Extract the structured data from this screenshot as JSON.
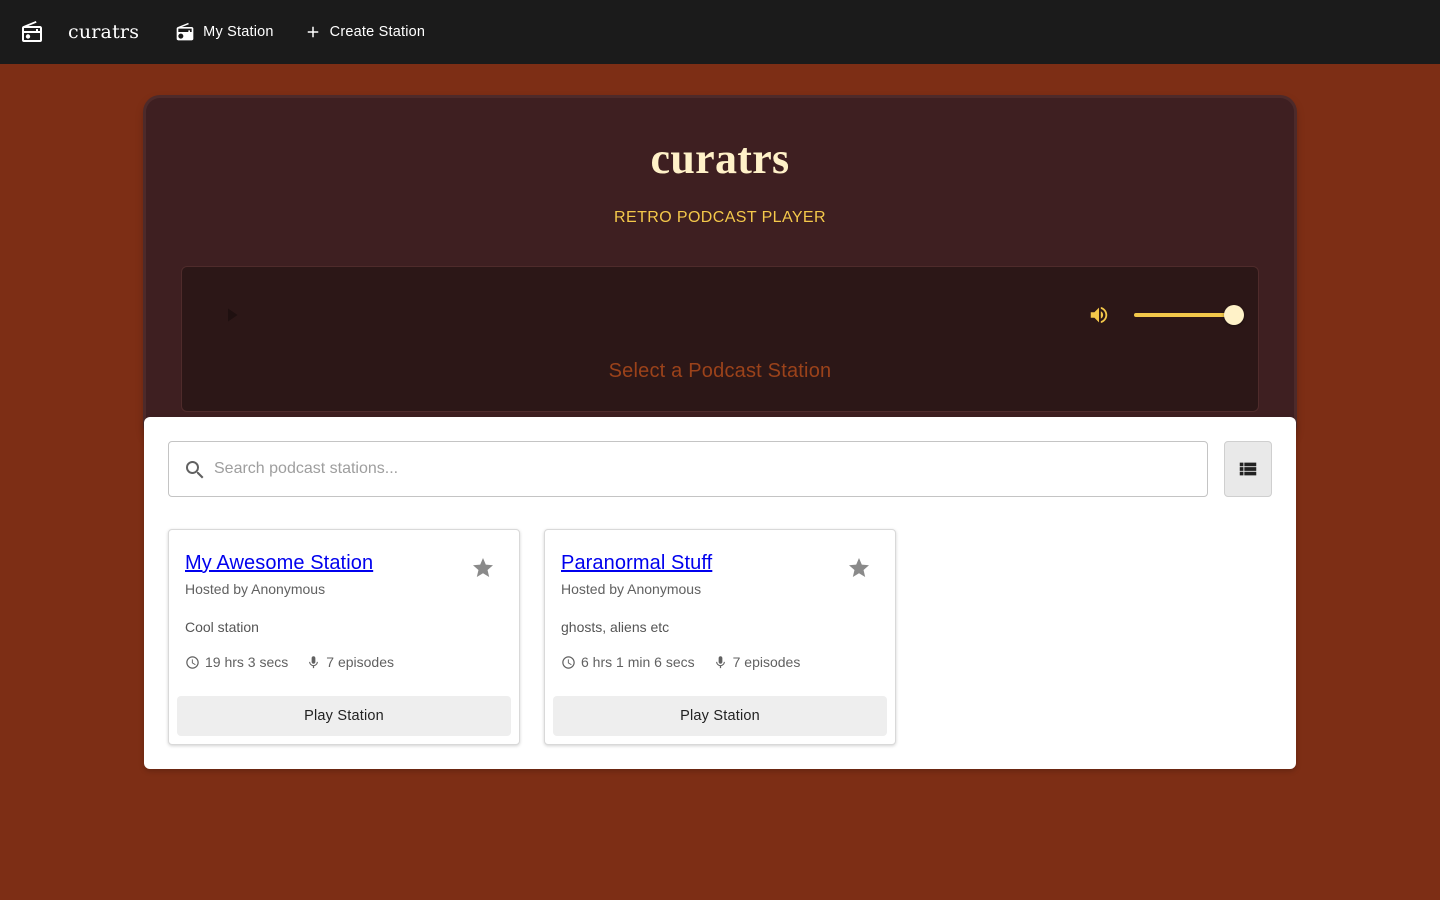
{
  "nav": {
    "brand": "curatrs",
    "my_station": "My Station",
    "create_station": "Create Station"
  },
  "player": {
    "title": "curatrs",
    "subtitle": "RETRO PODCAST PLAYER",
    "prompt": "Select a Podcast Station",
    "volume_percent": 100
  },
  "search": {
    "placeholder": "Search podcast stations..."
  },
  "stations": [
    {
      "name": "My Awesome Station",
      "host": "Hosted by Anonymous",
      "description": "Cool station",
      "duration": "19 hrs 3 secs",
      "episodes": "7 episodes",
      "play_label": "Play Station"
    },
    {
      "name": "Paranormal Stuff",
      "host": "Hosted by Anonymous",
      "description": "ghosts, aliens etc",
      "duration": "6 hrs 1 min 6 secs",
      "episodes": "7 episodes",
      "play_label": "Play Station"
    }
  ],
  "colors": {
    "page_bg": "#7d2e15",
    "topbar_bg": "#1b1b1b",
    "player_bg": "#3e1f21",
    "accent": "#f4c84a",
    "title_color": "#fff1c8"
  }
}
